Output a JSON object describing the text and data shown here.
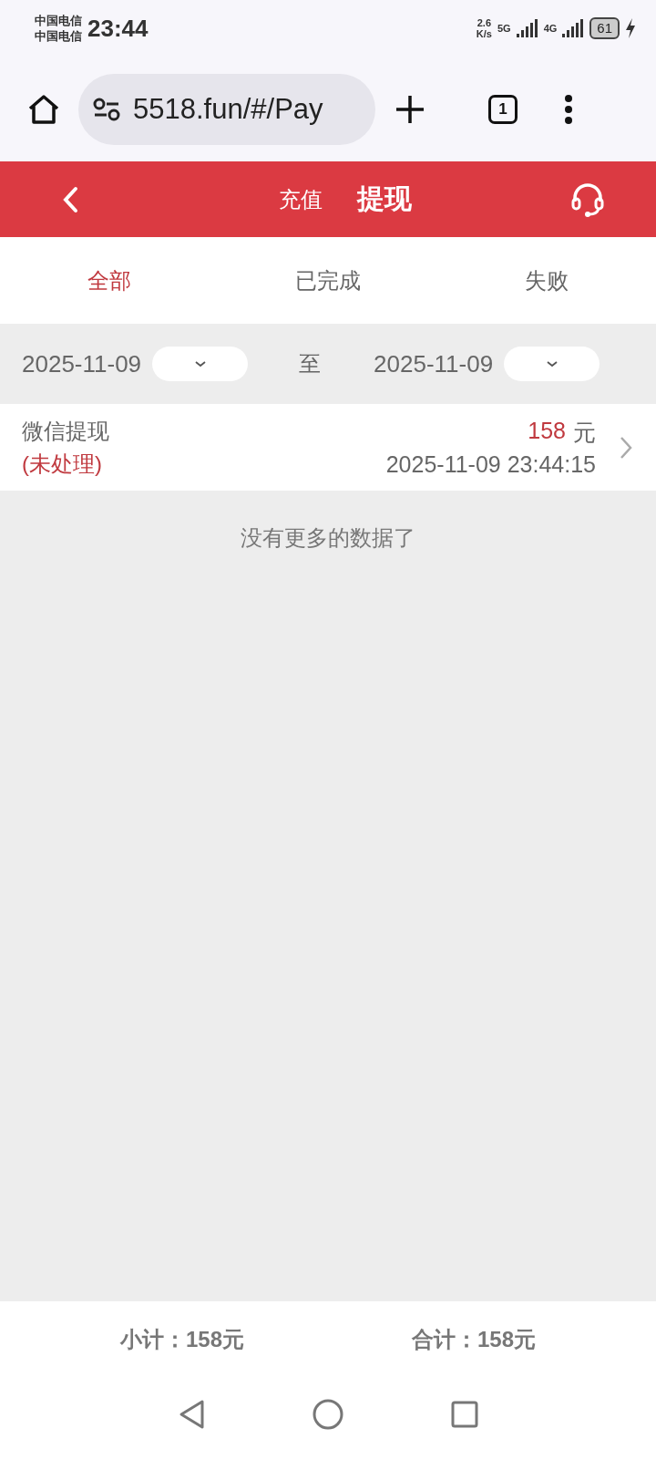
{
  "status_bar": {
    "carriers": [
      "中国电信",
      "中国电信"
    ],
    "time": "23:44",
    "net_speed": "2.6",
    "net_unit": "K/s",
    "sim_1": "5G",
    "sim_2": "4G",
    "battery": "61"
  },
  "browser": {
    "url": "5518.fun/#/Pay",
    "tab_count": "1"
  },
  "header": {
    "tabs": [
      {
        "label": "充值",
        "selected": false
      },
      {
        "label": "提现",
        "selected": true
      }
    ]
  },
  "filter_tabs": [
    {
      "label": "全部",
      "selected": true
    },
    {
      "label": "已完成",
      "selected": false
    },
    {
      "label": "失败",
      "selected": false
    }
  ],
  "date_range": {
    "from": "2025-11-09",
    "separator": "至",
    "to": "2025-11-09"
  },
  "records": [
    {
      "title": "微信提现",
      "status": "(未处理)",
      "amount": "158",
      "unit": "元",
      "time": "2025-11-09 23:44:15"
    }
  ],
  "end_message": "没有更多的数据了",
  "footer": {
    "subtotal": "小计：158元",
    "total": "合计：158元"
  }
}
